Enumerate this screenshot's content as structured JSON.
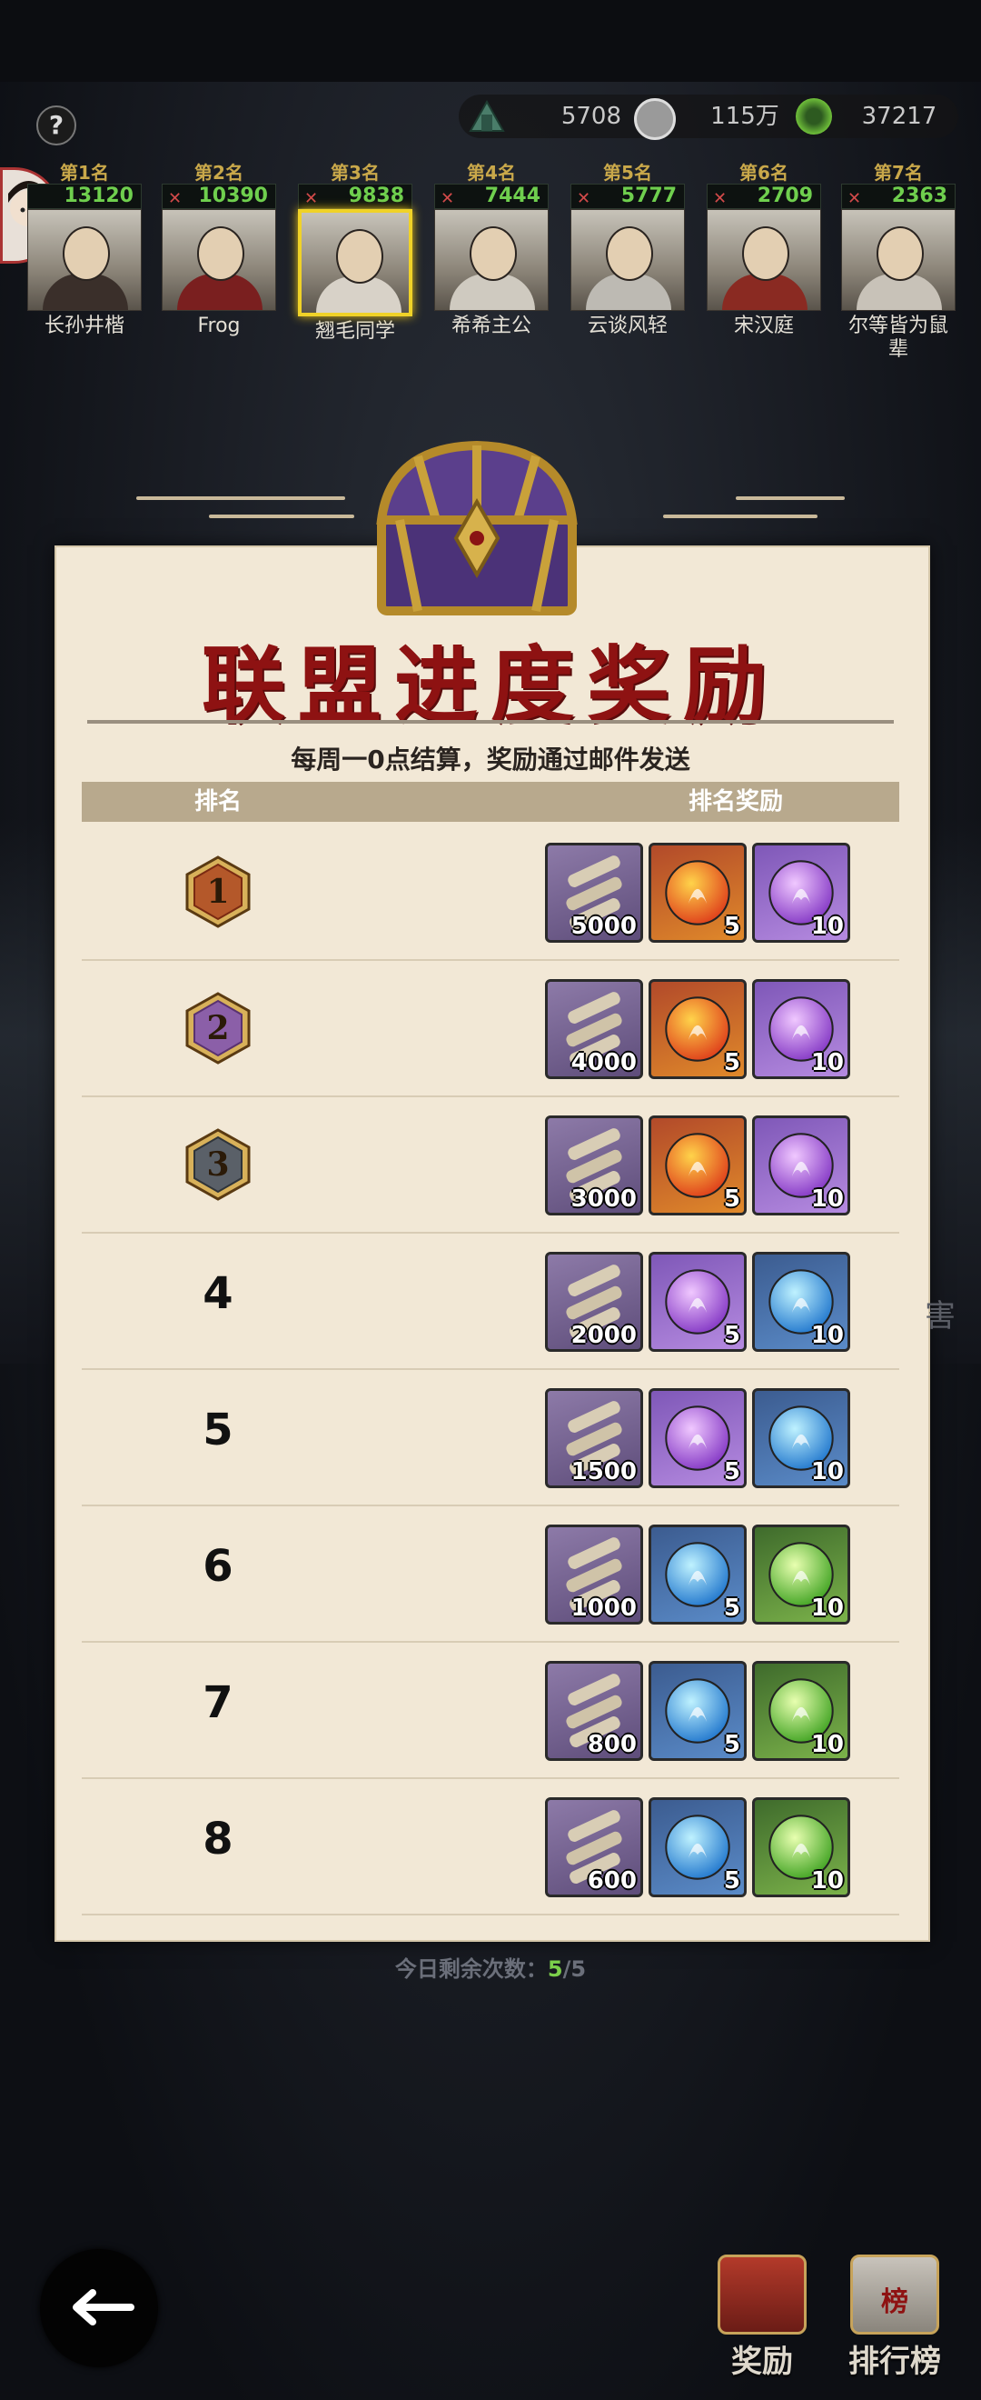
{
  "currency": {
    "tokens": "5708",
    "coins": "115万",
    "jade": "37217"
  },
  "ranking": [
    {
      "rank": "第1名",
      "score": "13120",
      "name": "长孙井楷"
    },
    {
      "rank": "第2名",
      "score": "10390",
      "name": "Frog"
    },
    {
      "rank": "第3名",
      "score": "9838",
      "name": "翘毛同学"
    },
    {
      "rank": "第4名",
      "score": "7444",
      "name": "希希主公"
    },
    {
      "rank": "第5名",
      "score": "5777",
      "name": "云谈风轻"
    },
    {
      "rank": "第6名",
      "score": "2709",
      "name": "宋汉庭"
    },
    {
      "rank": "第7名",
      "score": "2363",
      "name": "尔等皆为鼠辈"
    }
  ],
  "panel": {
    "title": "联盟进度奖励",
    "subtitle": "每周一0点结算，奖励通过邮件发送",
    "col_rank": "排名",
    "col_reward": "排名奖励",
    "rows": [
      {
        "rank": "1",
        "rewards": [
          {
            "type": "scroll",
            "qty": "5000"
          },
          {
            "type": "orb-red",
            "qty": "5"
          },
          {
            "type": "orb-purple",
            "qty": "10"
          }
        ]
      },
      {
        "rank": "2",
        "rewards": [
          {
            "type": "scroll",
            "qty": "4000"
          },
          {
            "type": "orb-red",
            "qty": "5"
          },
          {
            "type": "orb-purple",
            "qty": "10"
          }
        ]
      },
      {
        "rank": "3",
        "rewards": [
          {
            "type": "scroll",
            "qty": "3000"
          },
          {
            "type": "orb-red",
            "qty": "5"
          },
          {
            "type": "orb-purple",
            "qty": "10"
          }
        ]
      },
      {
        "rank": "4",
        "rewards": [
          {
            "type": "scroll",
            "qty": "2000"
          },
          {
            "type": "orb-purple",
            "qty": "5"
          },
          {
            "type": "orb-blue",
            "qty": "10"
          }
        ]
      },
      {
        "rank": "5",
        "rewards": [
          {
            "type": "scroll",
            "qty": "1500"
          },
          {
            "type": "orb-purple",
            "qty": "5"
          },
          {
            "type": "orb-blue",
            "qty": "10"
          }
        ]
      },
      {
        "rank": "6",
        "rewards": [
          {
            "type": "scroll",
            "qty": "1000"
          },
          {
            "type": "orb-blue",
            "qty": "5"
          },
          {
            "type": "orb-green",
            "qty": "10"
          }
        ]
      },
      {
        "rank": "7",
        "rewards": [
          {
            "type": "scroll",
            "qty": "800"
          },
          {
            "type": "orb-blue",
            "qty": "5"
          },
          {
            "type": "orb-green",
            "qty": "10"
          }
        ]
      },
      {
        "rank": "8",
        "rewards": [
          {
            "type": "scroll",
            "qty": "600"
          },
          {
            "type": "orb-blue",
            "qty": "5"
          },
          {
            "type": "orb-green",
            "qty": "10"
          }
        ]
      }
    ]
  },
  "remaining": {
    "label": "今日剩余次数：",
    "used": "5",
    "total": "/5"
  },
  "bottom": {
    "reward_label": "奖励",
    "leaderboard_label": "排行榜",
    "leaderboard_badge": "榜"
  },
  "side_text": "害",
  "icons": {
    "help": "?",
    "back": "back-arrow-icon"
  },
  "colors": {
    "title": "#8e1212",
    "panel_bg": "#f2e8d6",
    "header_bg": "#b8a98d",
    "score": "#6fcf4e",
    "highlight": "#f0d228"
  }
}
